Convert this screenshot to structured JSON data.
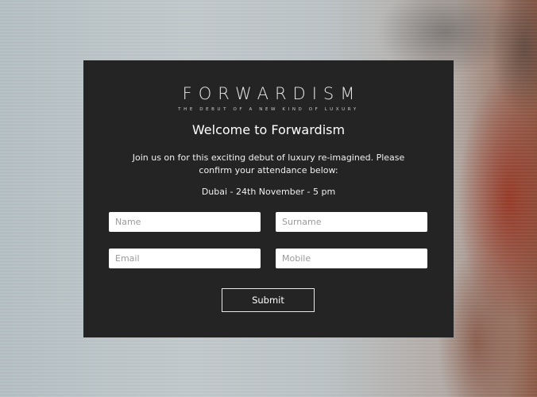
{
  "brand": {
    "logo": "FORWARDISM",
    "tagline": "THE DEBUT OF A NEW KIND OF LUXURY"
  },
  "modal": {
    "title": "Welcome to Forwardism",
    "intro": "Join us on for this exciting debut of luxury re-imagined. Please confirm your attendance below:",
    "event": "Dubai - 24th November - 5 pm"
  },
  "form": {
    "name_placeholder": "Name",
    "surname_placeholder": "Surname",
    "email_placeholder": "Email",
    "mobile_placeholder": "Mobile",
    "name_value": "",
    "surname_value": "",
    "email_value": "",
    "mobile_value": "",
    "submit_label": "Submit"
  },
  "colors": {
    "modal_background": "#242424",
    "text": "#ffffff",
    "field_background": "#ffffff"
  }
}
